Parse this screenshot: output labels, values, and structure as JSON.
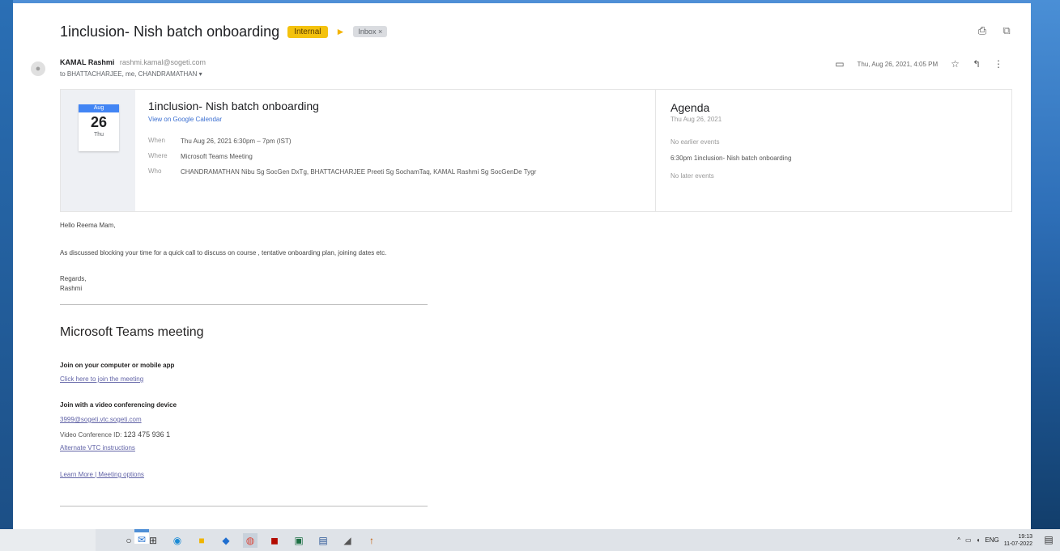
{
  "email": {
    "subject": "1inclusion- Nish batch onboarding",
    "label": "Internal",
    "inbox_tag": "Inbox ×",
    "sender_name": "KAMAL Rashmi",
    "sender_email": "rashmi.kamal@sogeti.com",
    "recipients": "to BHATTACHARJEE, me, CHANDRAMATHAN ▾",
    "date": "Thu, Aug 26, 2021, 4:05 PM"
  },
  "invite": {
    "month": "Aug",
    "day": "26",
    "weekday": "Thu",
    "title": "1inclusion- Nish batch onboarding",
    "view_link": "View on Google Calendar",
    "when_key": "When",
    "when": "Thu Aug 26, 2021 6:30pm – 7pm (IST)",
    "where_key": "Where",
    "where": "Microsoft Teams Meeting",
    "who_key": "Who",
    "who": "CHANDRAMATHAN Nibu Sg SocGen DxTg, BHATTACHARJEE Preeti Sg SochamTaq, KAMAL Rashmi Sg SocGenDe Tygr"
  },
  "agenda": {
    "title": "Agenda",
    "date": "Thu Aug 26, 2021",
    "earlier": "No earlier events",
    "event": "6:30pm   1inclusion- Nish batch onboarding",
    "later": "No later events"
  },
  "body": {
    "greeting": "Hello Reema Mam,",
    "message": "As discussed blocking your time for a quick call to discuss on course , tentative onboarding plan, joining dates etc.",
    "regards": "Regards,",
    "signature": "Rashmi"
  },
  "teams": {
    "title": "Microsoft Teams meeting",
    "join_app": "Join on your computer or mobile app",
    "join_link": "Click here to join the meeting",
    "join_device": "Join with a video conferencing device",
    "vtc_address": "3999@sogeti.vtc.sogeti.com",
    "vc_label": "Video Conference ID:",
    "vc_id": "123 475 936 1",
    "alt_vtc": "Alternate VTC instructions",
    "learn_more": "Learn More | Meeting options"
  },
  "tray": {
    "lang": "ENG",
    "time": "19:13",
    "date": "11-07-2022"
  }
}
